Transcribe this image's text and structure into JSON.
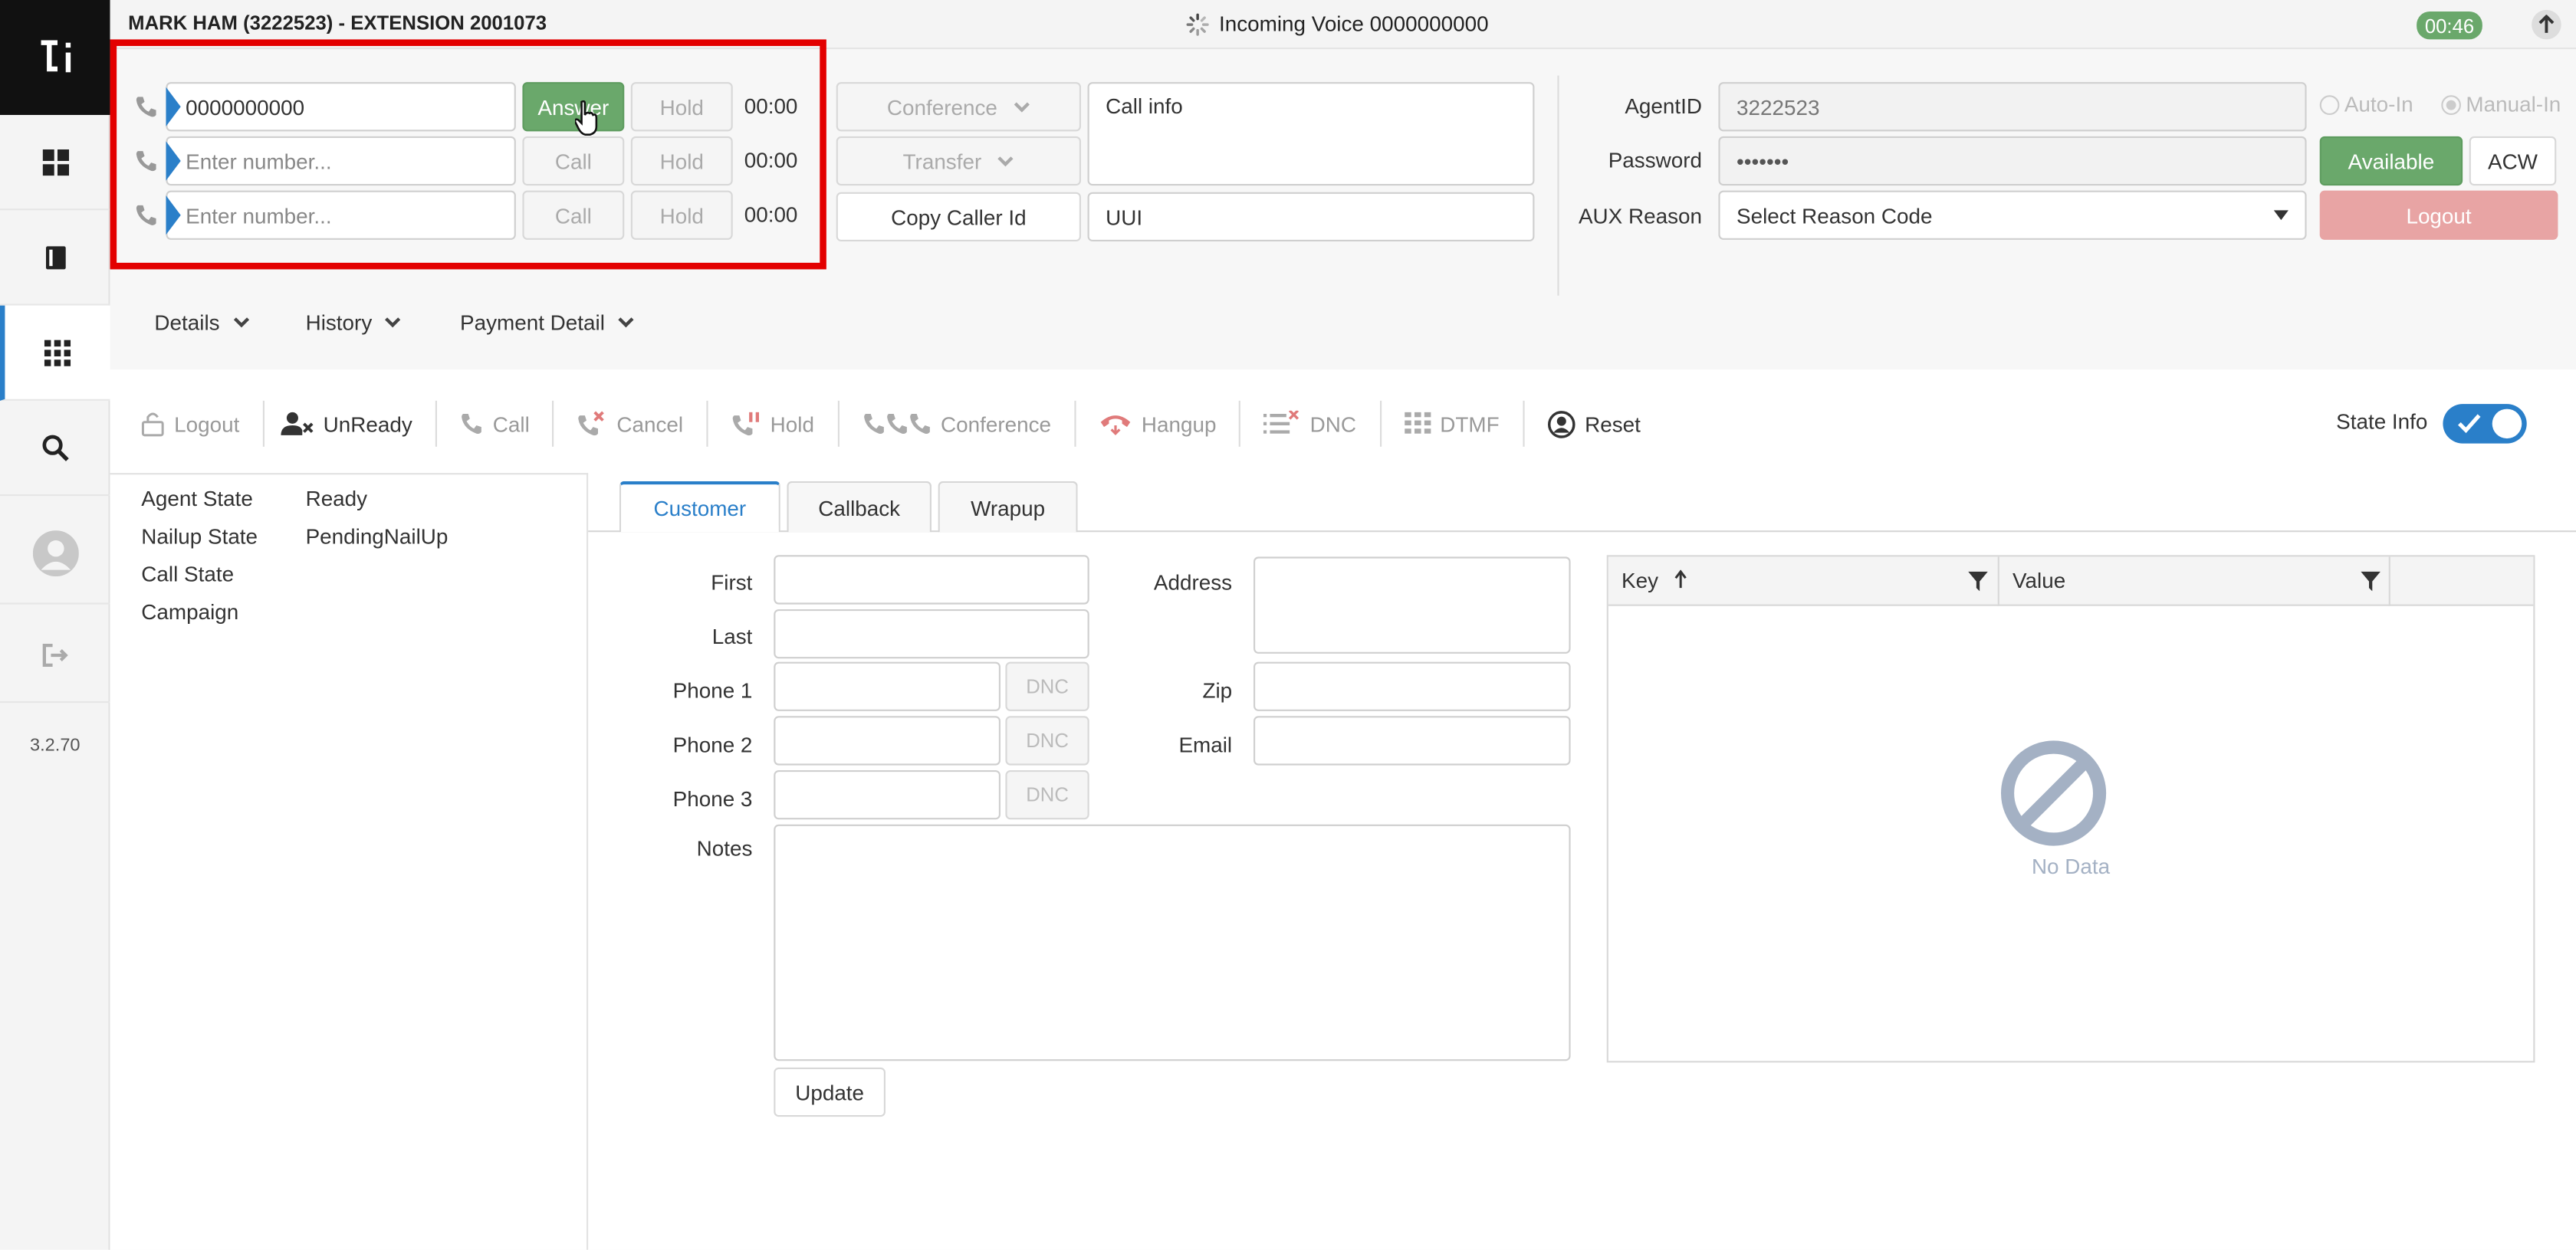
{
  "sidebar": {
    "version": "3.2.70"
  },
  "header": {
    "agent_title": "MARK HAM (3222523) - EXTENSION 2001073",
    "status": "Incoming Voice 0000000000",
    "timer": "00:46"
  },
  "lines": [
    {
      "value": "0000000000",
      "placeholder": "",
      "action": "Answer",
      "hold": "Hold",
      "time": "00:00"
    },
    {
      "value": "",
      "placeholder": "Enter number...",
      "action": "Call",
      "hold": "Hold",
      "time": "00:00"
    },
    {
      "value": "",
      "placeholder": "Enter number...",
      "action": "Call",
      "hold": "Hold",
      "time": "00:00"
    }
  ],
  "call_controls": {
    "conference": "Conference",
    "transfer": "Transfer",
    "copy_caller_id": "Copy Caller Id"
  },
  "call_info": {
    "placeholder": "Call info",
    "uui_placeholder": "UUI"
  },
  "agent": {
    "agent_id_label": "AgentID",
    "agent_id": "3222523",
    "password_label": "Password",
    "password": "•••••••",
    "aux_label": "AUX Reason",
    "aux_value": "Select Reason Code",
    "auto_in": "Auto-In",
    "manual_in": "Manual-In",
    "available": "Available",
    "acw": "ACW",
    "logout": "Logout"
  },
  "sections": {
    "details": "Details",
    "history": "History",
    "payment": "Payment Detail"
  },
  "toolbar": {
    "logout": "Logout",
    "unready": "UnReady",
    "call": "Call",
    "cancel": "Cancel",
    "hold": "Hold",
    "conference": "Conference",
    "hangup": "Hangup",
    "dnc": "DNC",
    "dtmf": "DTMF",
    "reset": "Reset",
    "state_info": "State Info"
  },
  "state": {
    "labels": [
      "Agent State",
      "Nailup State",
      "Call State",
      "Campaign"
    ],
    "values": [
      "Ready",
      "PendingNailUp",
      "",
      ""
    ]
  },
  "tabs": [
    "Customer",
    "Callback",
    "Wrapup"
  ],
  "form": {
    "first": "First",
    "last": "Last",
    "phone1": "Phone 1",
    "phone2": "Phone 2",
    "phone3": "Phone 3",
    "dnc": "DNC",
    "notes": "Notes",
    "address": "Address",
    "zip": "Zip",
    "email": "Email",
    "update": "Update"
  },
  "grid": {
    "col_key": "Key",
    "col_value": "Value",
    "empty": "No Data"
  },
  "colors": {
    "accent": "#2a7fc9",
    "answer_green": "#6aa86b",
    "logout_red": "#e8a4a4",
    "highlight_red": "#e30000"
  }
}
